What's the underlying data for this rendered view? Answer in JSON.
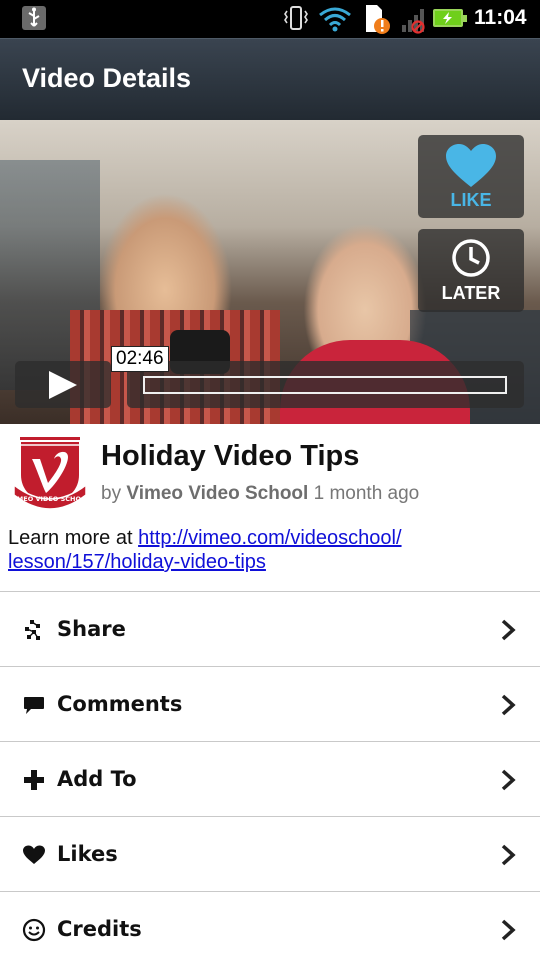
{
  "status_bar": {
    "time": "11:04",
    "icons": [
      "usb-icon",
      "vibrate-icon",
      "wifi-icon",
      "sd-card-alert-icon",
      "signal-no-service-icon",
      "battery-charging-icon"
    ]
  },
  "header": {
    "title": "Video Details"
  },
  "video": {
    "like_label": "LIKE",
    "later_label": "LATER",
    "time": "02:46",
    "accent_color": "#49b6e6"
  },
  "info": {
    "title": "Holiday Video Tips",
    "by_prefix": "by",
    "author": "Vimeo Video School",
    "age": "1 month ago",
    "logo_text": "VIMEO VIDEO SCHOOL",
    "description_prefix": "Learn more at ",
    "link_line1": "http://vimeo.com/videoschool/",
    "link_line2": "lesson/157/holiday-video-tips"
  },
  "menu": {
    "items": [
      {
        "label": "Share",
        "icon": "share-icon"
      },
      {
        "label": "Comments",
        "icon": "comment-icon"
      },
      {
        "label": "Add To",
        "icon": "plus-icon"
      },
      {
        "label": "Likes",
        "icon": "heart-icon"
      },
      {
        "label": "Credits",
        "icon": "smiley-icon"
      }
    ]
  }
}
